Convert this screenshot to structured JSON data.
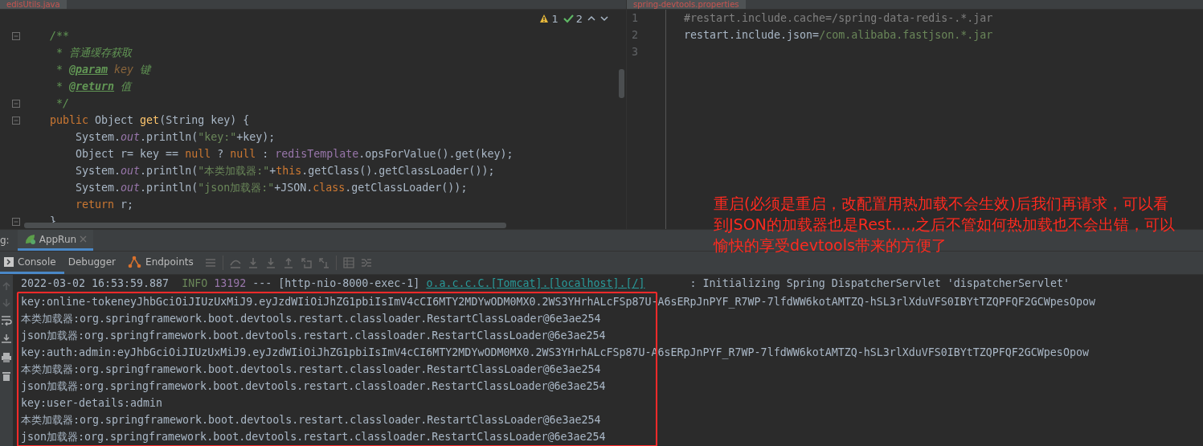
{
  "left_editor": {
    "tab": {
      "label": "edisUtils.java",
      "selected": true
    },
    "inspections": {
      "warnings": "1",
      "passed": "2"
    },
    "lines": [
      {
        "fold": true,
        "tokens": [
          {
            "t": "/**",
            "kind": "comment"
          }
        ]
      },
      {
        "fold": false,
        "tokens": [
          {
            "t": " * 普通缓存获取",
            "kind": "comment"
          }
        ]
      },
      {
        "fold": false,
        "tokens": [
          {
            "t": " * ",
            "kind": "comment"
          },
          {
            "t": "@param",
            "kind": "doctag"
          },
          {
            "t": " key",
            "kind": "docparam"
          },
          {
            "t": " 键",
            "kind": "comment"
          }
        ]
      },
      {
        "fold": false,
        "tokens": [
          {
            "t": " * ",
            "kind": "comment"
          },
          {
            "t": "@return",
            "kind": "doctag"
          },
          {
            "t": " 值",
            "kind": "comment"
          }
        ]
      },
      {
        "fold": true,
        "tokens": [
          {
            "t": " */",
            "kind": "comment"
          }
        ]
      },
      {
        "fold": true,
        "tokens": [
          {
            "t": "public",
            "kind": "keyword"
          },
          {
            "t": " Object ",
            "kind": "plain"
          },
          {
            "t": "get",
            "kind": "method"
          },
          {
            "t": "(String key) {",
            "kind": "plain"
          }
        ]
      },
      {
        "fold": false,
        "tokens": [
          {
            "t": "    System.",
            "kind": "plain"
          },
          {
            "t": "out",
            "kind": "static"
          },
          {
            "t": ".println(",
            "kind": "plain"
          },
          {
            "t": "\"key:\"",
            "kind": "string"
          },
          {
            "t": "+key);",
            "kind": "plain"
          }
        ]
      },
      {
        "fold": false,
        "tokens": [
          {
            "t": "    Object r= key == ",
            "kind": "plain"
          },
          {
            "t": "null",
            "kind": "keyword"
          },
          {
            "t": " ? ",
            "kind": "plain"
          },
          {
            "t": "null",
            "kind": "keyword"
          },
          {
            "t": " : ",
            "kind": "plain"
          },
          {
            "t": "redisTemplate",
            "kind": "field"
          },
          {
            "t": ".opsForValue().get(key);",
            "kind": "plain"
          }
        ]
      },
      {
        "fold": false,
        "tokens": [
          {
            "t": "    System.",
            "kind": "plain"
          },
          {
            "t": "out",
            "kind": "static"
          },
          {
            "t": ".println(",
            "kind": "plain"
          },
          {
            "t": "\"本类加载器:\"",
            "kind": "string"
          },
          {
            "t": "+",
            "kind": "plain"
          },
          {
            "t": "this",
            "kind": "keyword"
          },
          {
            "t": ".getClass().getClassLoader());",
            "kind": "plain"
          }
        ]
      },
      {
        "fold": false,
        "tokens": [
          {
            "t": "    System.",
            "kind": "plain"
          },
          {
            "t": "out",
            "kind": "static"
          },
          {
            "t": ".println(",
            "kind": "plain"
          },
          {
            "t": "\"json加载器:\"",
            "kind": "string"
          },
          {
            "t": "+JSON.",
            "kind": "plain"
          },
          {
            "t": "class",
            "kind": "keyword"
          },
          {
            "t": ".getClassLoader());",
            "kind": "plain"
          }
        ]
      },
      {
        "fold": false,
        "tokens": [
          {
            "t": "    return",
            "kind": "keyword"
          },
          {
            "t": " r;",
            "kind": "plain"
          }
        ]
      },
      {
        "fold": true,
        "tokens": [
          {
            "t": "}",
            "kind": "plain"
          }
        ]
      }
    ]
  },
  "right_editor": {
    "tab": {
      "label": "spring-devtools.properties",
      "selected": true
    },
    "lines": [
      {
        "number": "1",
        "tokens": [
          {
            "t": "#restart.include.cache=/spring-data-redis-.*.jar",
            "kind": "comment_grey"
          }
        ]
      },
      {
        "number": "2",
        "tokens": [
          {
            "t": "restart.include.json=",
            "kind": "plain_grey"
          },
          {
            "t": "/com.alibaba.fastjson.*.jar",
            "kind": "string"
          }
        ]
      },
      {
        "number": "3"
      }
    ]
  },
  "debug_panel": {
    "label": "g:",
    "tabs": [
      {
        "label": "AppRun",
        "selected": true
      }
    ],
    "toolbar_tabs": [
      {
        "label": "Console",
        "kind": "console",
        "selected": true
      },
      {
        "label": "Debugger",
        "kind": "plain",
        "selected": false
      },
      {
        "label": "Endpoints",
        "kind": "endpoints",
        "selected": false
      }
    ],
    "console_lines": [
      {
        "tokens": [
          {
            "t": "2022-03-02 16:53:59.887  ",
            "kind": "plain"
          },
          {
            "t": "INFO",
            "kind": "info"
          },
          {
            "t": " 13192",
            "kind": "pid"
          },
          {
            "t": " --- [http-nio-8000-exec-1] ",
            "kind": "plain"
          },
          {
            "t": "o.a.c.c.C.[Tomcat].[localhost].[/]",
            "kind": "logger"
          },
          {
            "t": "       : Initializing Spring DispatcherServlet 'dispatcherServlet'",
            "kind": "plain"
          }
        ]
      }
    ],
    "highlight_frame": {
      "lines": [
        {
          "tokens": [
            {
              "t": "key:online-tokeneyJhbGciOiJIUzUxMiJ9.eyJzdWIiOiJhZG1pbiIsImV4cCI6MTY2MDYwODM0MX0.2WS3YHrhALcFSp87U-A6sERpJnPYF_R7WP-7lfdWW6kotAMTZQ-hSL3rlXduVFS0IBYtTZQPFQF2GCWpesOpow",
              "kind": "plain"
            }
          ]
        },
        {
          "tokens": [
            {
              "t": "本类加载器:org.springframework.boot.devtools.restart.classloader.RestartClassLoader@6e3ae254",
              "kind": "plain"
            }
          ]
        },
        {
          "tokens": [
            {
              "t": "json加载器:org.springframework.boot.devtools.restart.classloader.RestartClassLoader@6e3ae254",
              "kind": "plain"
            }
          ]
        },
        {
          "tokens": [
            {
              "t": "key:auth:admin:eyJhbGciOiJIUzUxMiJ9.eyJzdWIiOiJhZG1pbiIsImV4cCI6MTY2MDYwODM0MX0.2WS3YHrhALcFSp87U-A6sERpJnPYF_R7WP-7lfdWW6kotAMTZQ-hSL3rlXduVFS0IBYtTZQPFQF2GCWpesOpow",
              "kind": "plain"
            }
          ]
        },
        {
          "tokens": [
            {
              "t": "本类加载器:org.springframework.boot.devtools.restart.classloader.RestartClassLoader@6e3ae254",
              "kind": "plain"
            }
          ]
        },
        {
          "tokens": [
            {
              "t": "json加载器:org.springframework.boot.devtools.restart.classloader.RestartClassLoader@6e3ae254",
              "kind": "plain"
            }
          ]
        },
        {
          "tokens": [
            {
              "t": "key:user-details:admin",
              "kind": "plain"
            }
          ]
        },
        {
          "tokens": [
            {
              "t": "本类加载器:org.springframework.boot.devtools.restart.classloader.RestartClassLoader@6e3ae254",
              "kind": "plain"
            }
          ]
        },
        {
          "tokens": [
            {
              "t": "json加载器:org.springframework.boot.devtools.restart.classloader.RestartClassLoader@6e3ae254",
              "kind": "plain"
            }
          ]
        }
      ]
    }
  },
  "annotation": {
    "text": "重启(必须是重启，改配置用热加载不会生效)后我们再请求，可以看到JSON的加载器也是Rest....,之后不管如何热加载也不会出错，可以愉快的享受devtools带来的方便了"
  }
}
